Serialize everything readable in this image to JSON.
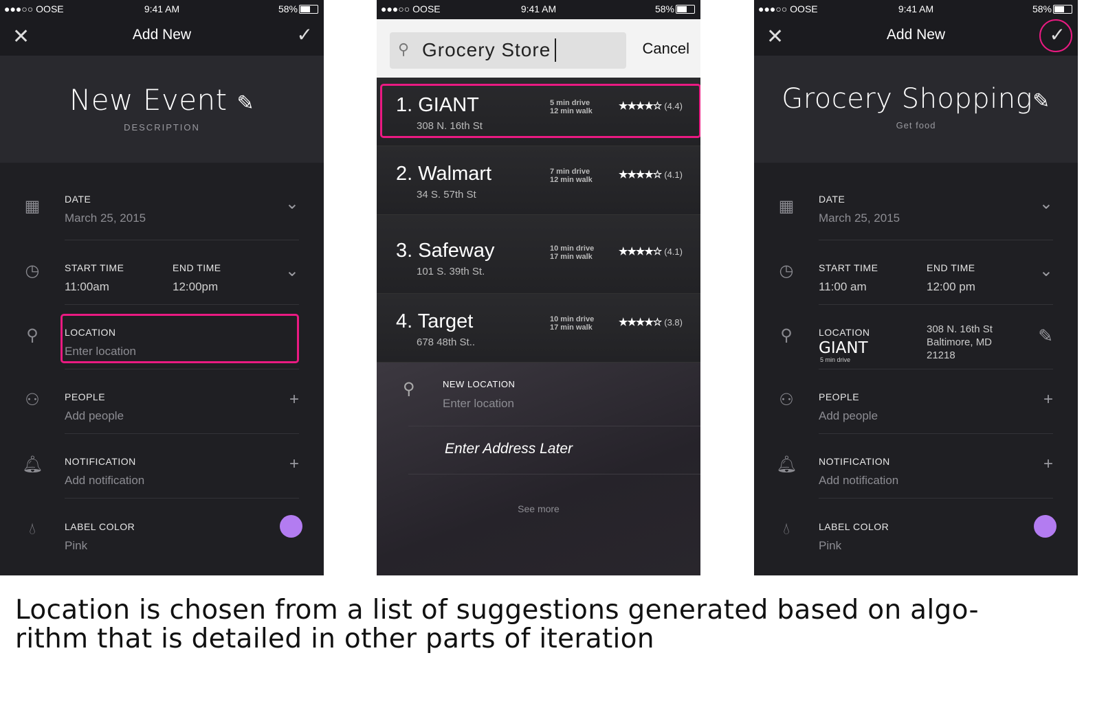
{
  "status": {
    "carrier": "●●●○○ OOSE",
    "time": "9:41 AM",
    "battery": "58%"
  },
  "colors": {
    "highlight": "#ea1a82",
    "label_color": "#b37cf1"
  },
  "left": {
    "nav": {
      "title": "Add New"
    },
    "header": {
      "title": "New Event",
      "description": "DESCRIPTION"
    },
    "date": {
      "label": "DATE",
      "value": "March 25, 2015"
    },
    "time": {
      "start_label": "START TIME",
      "start": "11:00am",
      "end_label": "END TIME",
      "end": "12:00pm"
    },
    "location": {
      "label": "LOCATION",
      "placeholder": "Enter location"
    },
    "people": {
      "label": "PEOPLE",
      "placeholder": "Add people"
    },
    "notification": {
      "label": "NOTIFICATION",
      "placeholder": "Add notification"
    },
    "label_color": {
      "label": "LABEL COLOR",
      "value": "Pink"
    }
  },
  "middle": {
    "search": {
      "query": "Grocery Store",
      "cancel": "Cancel"
    },
    "results": [
      {
        "name": "1. GIANT",
        "address": "308 N. 16th St",
        "drive": "5 min drive",
        "walk": "12 min walk",
        "rating": "(4.4)",
        "stars": 4
      },
      {
        "name": "2. Walmart",
        "address": "34 S. 57th St",
        "drive": "7 min drive",
        "walk": "12 min walk",
        "rating": "(4.1)",
        "stars": 4
      },
      {
        "name": "3. Safeway",
        "address": "101 S. 39th St.",
        "drive": "10 min drive",
        "walk": "17 min walk",
        "rating": "(4.1)",
        "stars": 4
      },
      {
        "name": "4. Target",
        "address": "678 48th St..",
        "drive": "10 min drive",
        "walk": "17 min walk",
        "rating": "(3.8)",
        "stars": 4
      }
    ],
    "new_location": {
      "label": "NEW LOCATION",
      "placeholder": "Enter location",
      "later": "Enter Address Later",
      "see_more": "See more"
    }
  },
  "right": {
    "nav": {
      "title": "Add New"
    },
    "header": {
      "title": "Grocery Shopping",
      "description": "Get food"
    },
    "date": {
      "label": "DATE",
      "value": "March 25, 2015"
    },
    "time": {
      "start_label": "START TIME",
      "start": "11:00 am",
      "end_label": "END TIME",
      "end": "12:00 pm"
    },
    "location": {
      "label": "LOCATION",
      "name": "GIANT",
      "drive": "5 min drive",
      "address1": "308 N. 16th St",
      "address2": "Baltimore, MD",
      "address3": "21218"
    },
    "people": {
      "label": "PEOPLE",
      "placeholder": "Add people"
    },
    "notification": {
      "label": "NOTIFICATION",
      "placeholder": "Add notification"
    },
    "label_color": {
      "label": "LABEL COLOR",
      "value": "Pink"
    }
  },
  "caption": "Location is chosen from a list of suggestions generated based on algo-rithm that is detailed in other parts of iteration"
}
